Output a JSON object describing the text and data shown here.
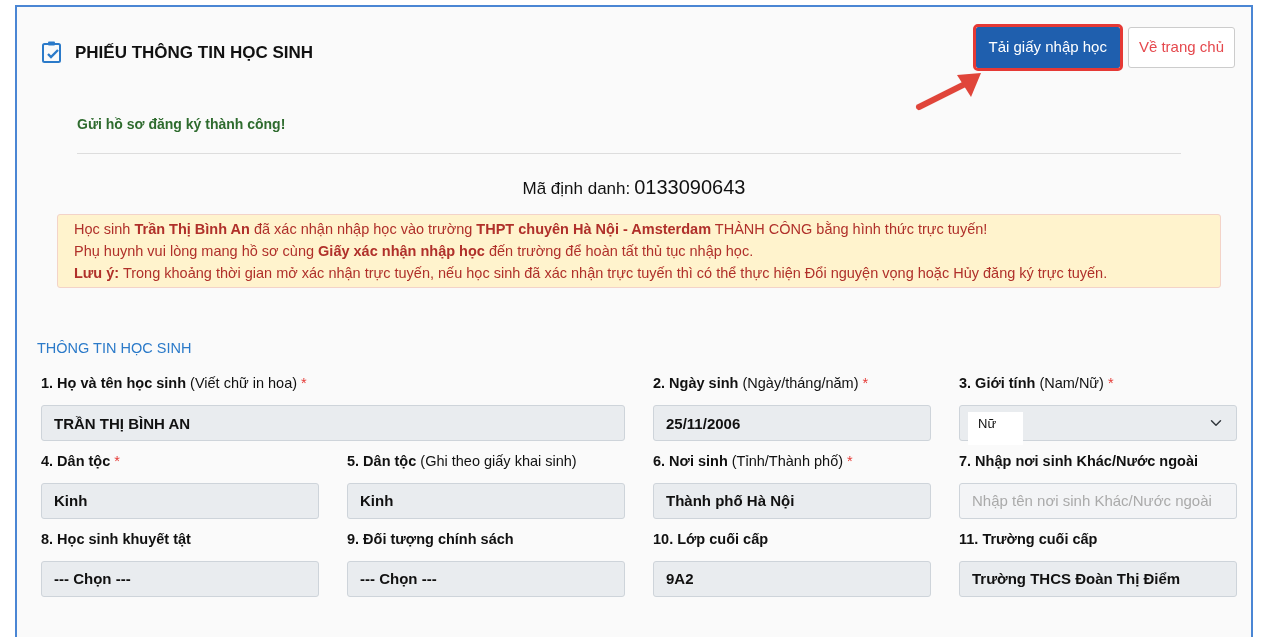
{
  "header": {
    "title": "PHIẾU THÔNG TIN HỌC SINH",
    "buttons": [
      {
        "label": "Tải giấy nhập học",
        "kind": "primary",
        "highlighted": true
      },
      {
        "label": "Về trang chủ",
        "kind": "outline"
      }
    ]
  },
  "success_message": "Gửi hồ sơ đăng ký thành công!",
  "identifier": {
    "label": "Mã định danh:",
    "value": "0133090643"
  },
  "notice": [
    "Học sinh **Trần Thị Bình An** đã xác nhận nhập học vào trường **THPT chuyên Hà Nội - Amsterdam** THÀNH CÔNG bằng hình thức trực tuyến!",
    "Phụ huynh vui lòng mang hồ sơ cùng **Giấy xác nhận nhập học** đến trường để hoàn tất thủ tục nhập học.",
    "**Lưu ý:** Trong khoảng thời gian mở xác nhận trực tuyến, nếu học sinh đã xác nhận trực tuyến thì có thể thực hiện Đổi nguyện vọng hoặc Hủy đăng ký trực tuyến."
  ],
  "section_title": "THÔNG TIN HỌC SINH",
  "fields": [
    {
      "label": "1. Họ và tên học sinh",
      "hint": "(Viết chữ in hoa)",
      "required": "*",
      "kind": "input",
      "value": "TRẦN THỊ BÌNH AN",
      "wide": true
    },
    {
      "label": "2. Ngày sinh",
      "hint": "(Ngày/tháng/năm)",
      "required": "*",
      "kind": "input",
      "value": "25/11/2006",
      "wide": false
    },
    {
      "label": "3. Giới tính",
      "hint": "(Nam/Nữ)",
      "required": "*",
      "kind": "chip-select",
      "value": "Nữ",
      "wide": false
    },
    {
      "label": "4. Dân tộc",
      "required": "*",
      "kind": "select",
      "value": "Kinh",
      "wide": false
    },
    {
      "label": "5. Dân tộc",
      "hint": "(Ghi theo giấy khai sinh)",
      "kind": "input",
      "value": "Kinh",
      "wide": false
    },
    {
      "label": "6. Nơi sinh",
      "hint": "(Tỉnh/Thành phố)",
      "required": "*",
      "kind": "select",
      "value": "Thành phố Hà Nội",
      "wide": false
    },
    {
      "label": "7. Nhập nơi sinh Khác/Nước ngoài",
      "kind": "input",
      "placeholder": "Nhập tên nơi sinh Khác/Nước ngoài",
      "wide": false
    },
    {
      "label": "8. Học sinh khuyết tật",
      "kind": "select",
      "value": "--- Chọn ---",
      "wide": false
    },
    {
      "label": "9. Đối tượng chính sách",
      "kind": "select",
      "value": "--- Chọn ---",
      "wide": false
    },
    {
      "label": "10. Lớp cuối cấp",
      "kind": "input",
      "value": "9A2",
      "wide": false
    },
    {
      "label": "11. Trường cuối cấp",
      "kind": "input",
      "value": "Trường THCS Đoàn Thị Điểm",
      "wide": false
    }
  ]
}
